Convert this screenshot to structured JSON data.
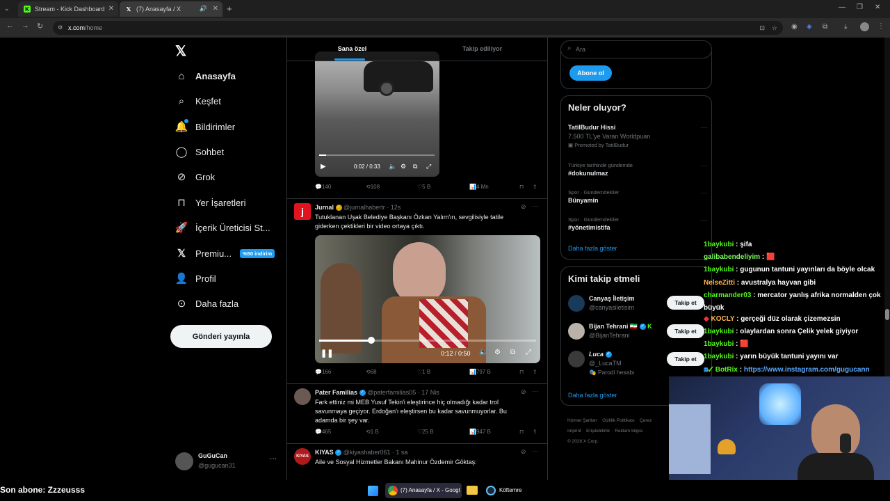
{
  "browser": {
    "tabs": [
      {
        "title": "Stream - Kick Dashboard"
      },
      {
        "title": "(7) Anasayfa / X"
      }
    ],
    "url_host": "x.com",
    "url_path": "/home"
  },
  "nav": {
    "items": [
      {
        "label": "Anasayfa",
        "icon": "home-icon"
      },
      {
        "label": "Keşfet",
        "icon": "search-icon"
      },
      {
        "label": "Bildirimler",
        "icon": "bell-icon"
      },
      {
        "label": "Sohbet",
        "icon": "chat-icon"
      },
      {
        "label": "Grok",
        "icon": "grok-icon"
      },
      {
        "label": "Yer İşaretleri",
        "icon": "bookmark-icon"
      },
      {
        "label": "İçerik Üreticisi St...",
        "icon": "rocket-icon"
      },
      {
        "label": "Premiu...",
        "icon": "x-icon",
        "badge": "%50 indirim"
      },
      {
        "label": "Profil",
        "icon": "person-icon"
      },
      {
        "label": "Daha fazla",
        "icon": "more-circle-icon"
      }
    ],
    "post_button": "Gönderi yayınla",
    "account": {
      "name": "GuGuCan",
      "handle": "@gugucan31"
    }
  },
  "timeline": {
    "tabs": [
      "Sana özel",
      "Takip ediliyor"
    ],
    "tweets": [
      {
        "video_time": "0:02 / 0:33",
        "actions": {
          "reply": "140",
          "retweet": "108",
          "like": "5 B",
          "views": "4 Mn"
        }
      },
      {
        "name": "Jurnal",
        "handle": "@jurnalhabertr",
        "time": "· 12s",
        "text": "Tutuklanan Uşak Belediye Başkanı Özkan Yalım'ın, sevgilisiyle tatile giderken çektikleri bir video ortaya çıktı.",
        "video_time": "0:12 / 0:50",
        "video_progress": 0.24,
        "actions": {
          "reply": "166",
          "retweet": "68",
          "like": "1 B",
          "views": "797 B"
        }
      },
      {
        "name": "Pater Familias",
        "handle": "@paterfamilias05",
        "time": "· 17 Nis",
        "text": "Fark ettiniz mi MEB Yusuf Tekin'i eleştirince hiç olmadığı kadar trol savunmaya geçiyor. Erdoğan'ı eleştirsen bu kadar savunmuyorlar. Bu adamda bir şey var.",
        "actions": {
          "reply": "465",
          "retweet": "1 B",
          "like": "25 B",
          "views": "947 B"
        }
      },
      {
        "name": "KIYAS",
        "handle": "@kiyashaber061",
        "time": "· 1 sa",
        "text": "Aile ve Sosyal Hizmetler Bakanı Mahinur Özdemir Göktaş:",
        "avatar_text": "KIYAS"
      }
    ]
  },
  "right": {
    "search_placeholder": "Ara",
    "subscribe_button": "Abone ol",
    "trends_title": "Neler oluyor?",
    "trends": [
      {
        "title": "TatilBudur Hissi",
        "sub": "7.500 TL'ye Varan Worldpuan",
        "meta": "Promoted by TatilBudur"
      },
      {
        "meta": "Türkiye tarihinde gündemde",
        "title": "#dokunulmaz"
      },
      {
        "meta": "Spor · Gündemdekiler",
        "title": "Bünyamin"
      },
      {
        "meta": "Spor · Gündemdekiler",
        "title": "#yönetimistifa"
      }
    ],
    "show_more": "Daha fazla göster",
    "who_to_follow_title": "Kimi takip etmeli",
    "suggestions": [
      {
        "name": "Canyaş İletişim",
        "handle": "@canyasiletisim",
        "button": "Takip et"
      },
      {
        "name": "Bijan Tehrani 🇮🇷",
        "handle": "@BijanTehrani",
        "button": "Takip et"
      },
      {
        "name": "Luca",
        "handle": "@_LucaTM",
        "note": "Parodi hesabı",
        "button": "Takip et"
      }
    ],
    "show_more_2": "Daha fazla göster",
    "footer": [
      "Hizmet Şartları",
      "Gizlilik Politikası",
      "Çerez",
      "Imprint",
      "Erişilebilirlik",
      "Reklam bilgisi",
      "© 2026 X Corp."
    ]
  },
  "chat": [
    {
      "user": "1baykubi",
      "msg": "şifa"
    },
    {
      "user": "galibabendeliyim",
      "msg": "🟥",
      "color": "#53fc18"
    },
    {
      "user": "1baykubi",
      "msg": "gugunun tantuni yayınları da böyle olcak"
    },
    {
      "user": "NelseZitti",
      "msg": "avustralya hayvan gibi",
      "color": "#ffb74d"
    },
    {
      "user": "charmander03",
      "msg": "mercator yanlış afrika normalden çok büyük"
    },
    {
      "user": "KOCLY",
      "msg": "gerçeği düz olarak çizemezsin",
      "color": "#ffb74d"
    },
    {
      "user": "1baykubi",
      "msg": "olaylardan sonra Çelik yelek giyiyor"
    },
    {
      "user": "1baykubi",
      "msg": "🟥"
    },
    {
      "user": "1baykubi",
      "msg": "yarın büyük tantuni yayını var"
    },
    {
      "user": "BotRix",
      "msg": "https://www.instagram.com/gugucann",
      "color": "#53fc18"
    }
  ],
  "overlay": {
    "last_sub": "Son abone: Zzzeusss"
  },
  "taskbar": {
    "items": [
      "(7) Anasayfa / X - Googl",
      "Köftemre"
    ]
  }
}
